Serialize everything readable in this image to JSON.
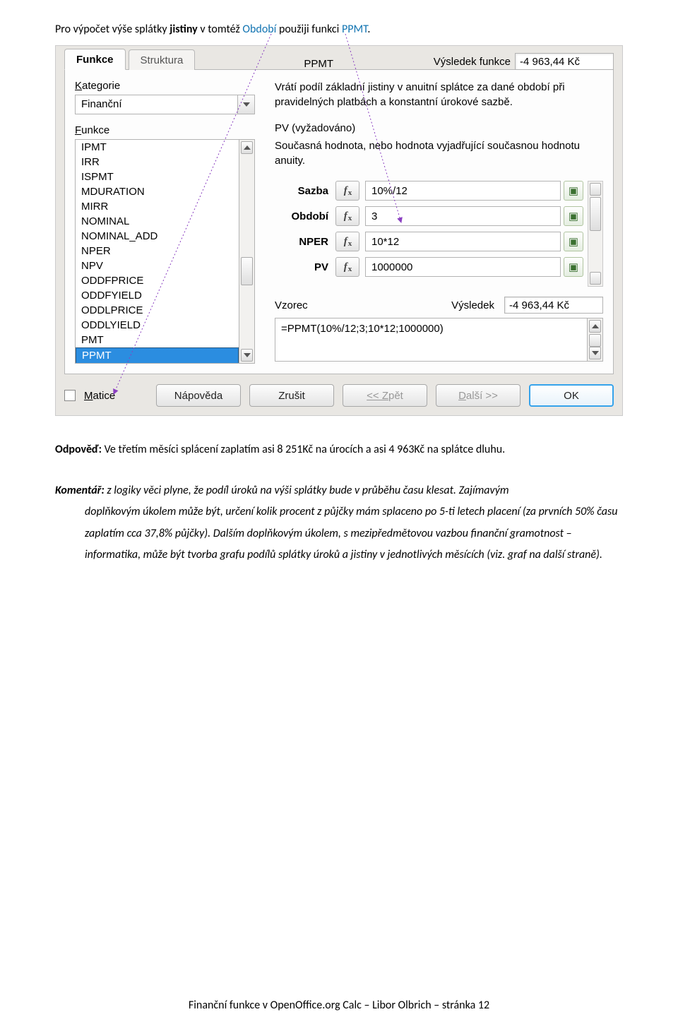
{
  "intro": {
    "p1": "Pro výpočet výše splátky ",
    "bold": "jistiny",
    "p2": " v tomtéž ",
    "blue1": "Období",
    "p3": " použiji funkci ",
    "blue2": "PPMT",
    "p4": "."
  },
  "wizard": {
    "tabs": {
      "t0": "Funkce",
      "t1": "Struktura"
    },
    "fnTitle": "PPMT",
    "fnResultLabel": "Výsledek funkce",
    "fnResultValue": "-4 963,44 Kč",
    "catLabel_pre": "K",
    "catLabel_post": "ategorie",
    "catValue": "Finanční",
    "funcLabel_pre": "F",
    "funcLabel_post": "unkce",
    "funcList": [
      "IPMT",
      "IRR",
      "ISPMT",
      "MDURATION",
      "MIRR",
      "NOMINAL",
      "NOMINAL_ADD",
      "NPER",
      "NPV",
      "ODDFPRICE",
      "ODDFYIELD",
      "ODDLPRICE",
      "ODDLYIELD",
      "PMT",
      "PPMT"
    ],
    "selectedFunc": "PPMT",
    "desc": "Vrátí podíl základní jistiny v anuitní splátce za dané období při pravidelných platbách a konstantní úrokové sazbě.",
    "reqLabel": "PV (vyžadováno)",
    "reqDesc": "Současná hodnota, nebo hodnota vyjadřující současnou hodnotu anuity.",
    "args": [
      {
        "name": "Sazba",
        "val": "10%/12",
        "bold": true
      },
      {
        "name": "Období",
        "val": "3",
        "bold": true
      },
      {
        "name": "NPER",
        "val": "10*12",
        "bold": true
      },
      {
        "name": "PV",
        "val": "1000000",
        "bold": true
      }
    ],
    "formulaLabel": "Vzorec",
    "resultLabel": "Výsledek",
    "resultValue": "-4 963,44 Kč",
    "formula": "=PPMT(10%/12;3;10*12;1000000)",
    "matrixPre": "M",
    "matrixPost": "atice",
    "btnHelp": "Nápověda",
    "btnCancel": "Zrušit",
    "btnBack": "<< Zpět",
    "btnNext": "Další >>",
    "btnOk": "OK"
  },
  "answer": {
    "lead": "Odpověď:",
    "body": " Ve třetím měsíci splácení zaplatím asi 8 251Kč na úrocích a asi 4 963Kč na splátce dluhu."
  },
  "comment": {
    "lead": "Komentář:",
    "body1": " z logiky věci plyne, že podíl úroků na výši splátky bude v průběhu času klesat. Zajímavým",
    "body2": "doplňkovým úkolem může být, určení kolik procent z půjčky mám splaceno po 5-ti letech placení (za prvních 50% času zaplatím cca 37,8% půjčky). Dalším doplňkovým úkolem, s mezipředmětovou vazbou finanční gramotnost – informatika, může být tvorba grafu podílů splátky úroků a jistiny v jednotlivých měsících (viz. graf na další straně)."
  },
  "footer": "Finanční funkce v OpenOffice.org Calc – Libor Olbrich – stránka 12"
}
